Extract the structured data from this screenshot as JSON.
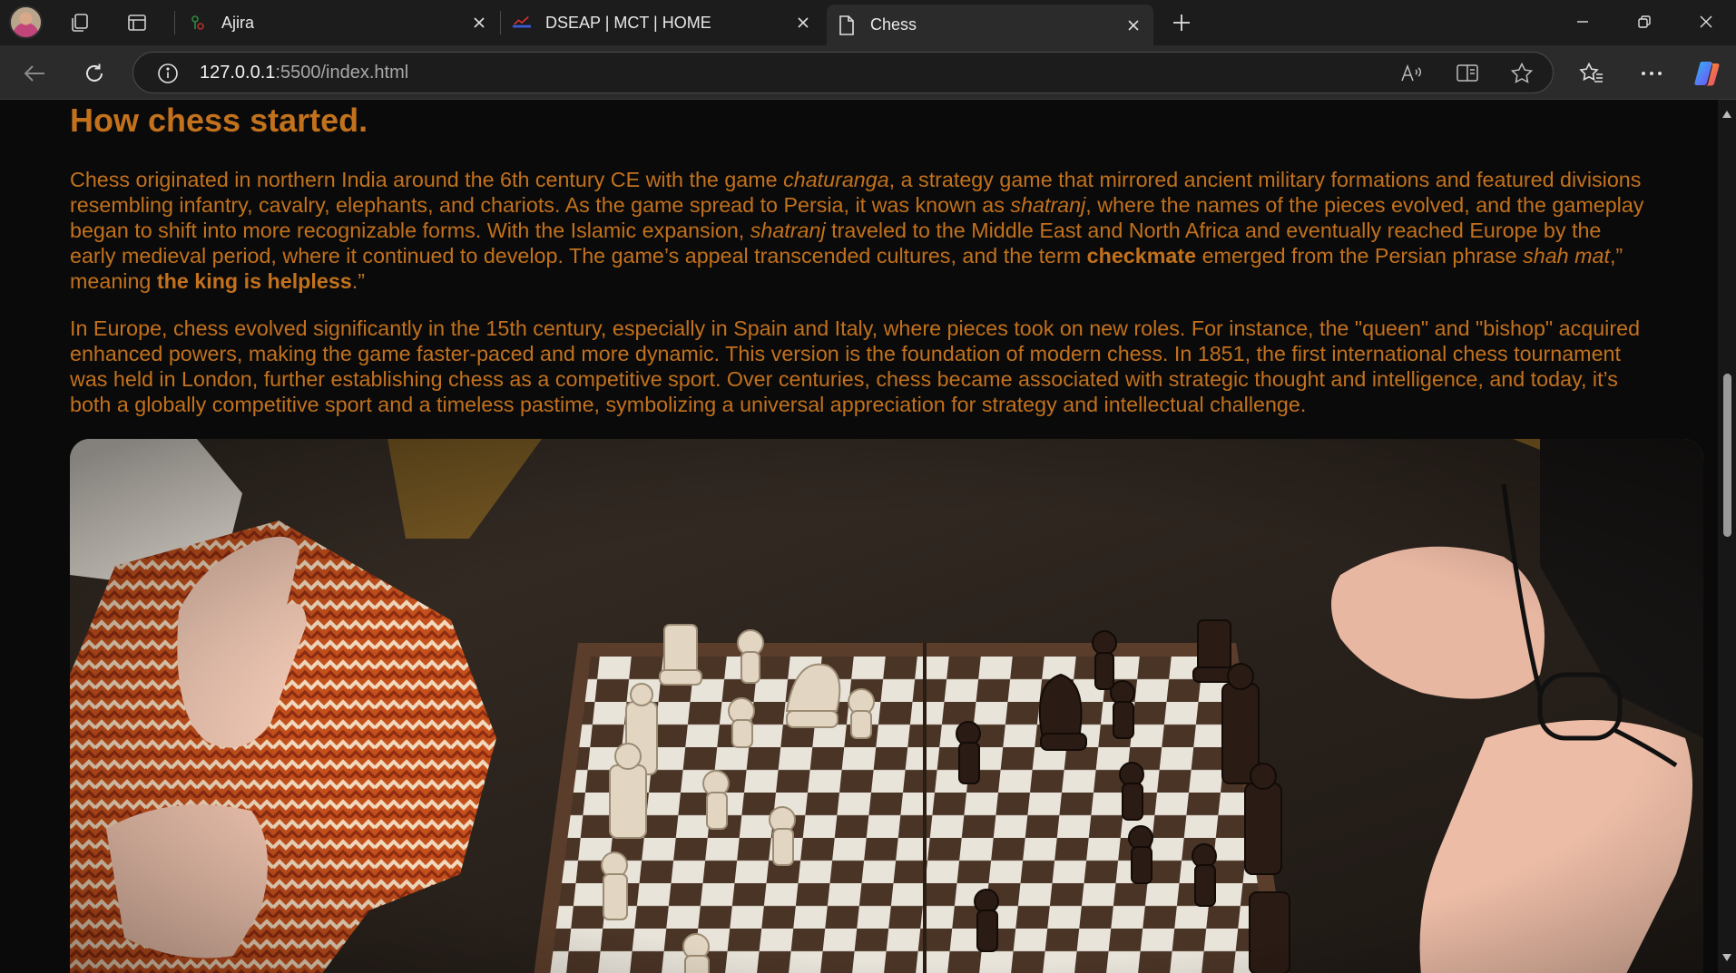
{
  "browser": {
    "tabs": [
      {
        "title": "Ajira",
        "active": false
      },
      {
        "title": "DSEAP | MCT | HOME",
        "active": false
      },
      {
        "title": "Chess",
        "active": true
      }
    ],
    "address": {
      "host": "127.0.0.1",
      "path": ":5500/index.html"
    }
  },
  "page": {
    "heading": "How chess started.",
    "paragraph1": {
      "t1": "Chess originated in northern India around the 6th century CE with the game ",
      "i1": "chaturanga",
      "t2": ", a strategy game that mirrored ancient military formations and featured divisions resembling infantry, cavalry, elephants, and chariots. As the game spread to Persia, it was known as ",
      "i2": "shatranj",
      "t3": ", where the names of the pieces evolved, and the gameplay began to shift into more recognizable forms. With the Islamic expansion, ",
      "i3": "shatranj",
      "t4": " traveled to the Middle East and North Africa and eventually reached Europe by the early medieval period, where it continued to develop. The game’s appeal transcended cultures, and the term ",
      "b1": "checkmate",
      "t5": " emerged from the Persian phrase ",
      "i4": "shah mat",
      "t6": ",” meaning ",
      "b2": "the king is helpless",
      "t7": ".”"
    },
    "paragraph2": "In Europe, chess evolved significantly in the 15th century, especially in Spain and Italy, where pieces took on new roles. For instance, the \"queen\" and \"bishop\" acquired enhanced powers, making the game faster-paced and more dynamic. This version is the foundation of modern chess. In 1851, the first international chess tournament was held in London, further establishing chess as a competitive sport. Over centuries, chess became associated with strategic thought and intelligence, and today, it’s both a globally competitive sport and a timeless pastime, symbolizing a universal appreciation for strategy and intellectual challenge."
  },
  "colors": {
    "text_accent": "#c2711d",
    "page_background": "#0a0a0a"
  }
}
